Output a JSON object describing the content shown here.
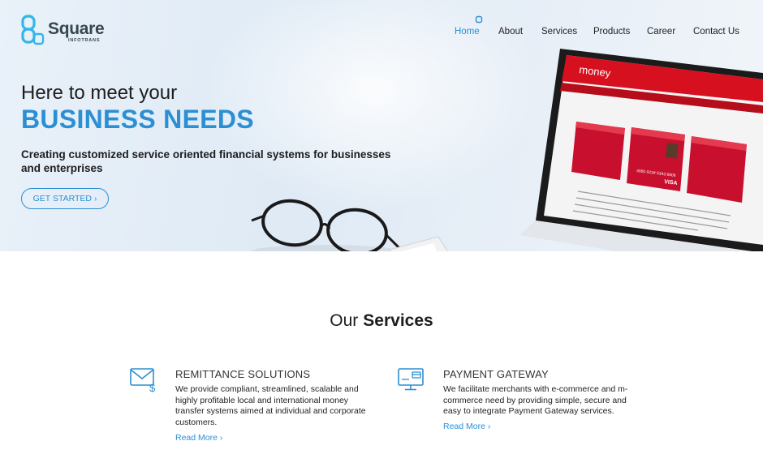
{
  "logo": {
    "name": "Square",
    "sub": "INFOTRANS"
  },
  "nav": {
    "items": [
      {
        "label": "Home",
        "active": true
      },
      {
        "label": "About"
      },
      {
        "label": "Services"
      },
      {
        "label": "Products"
      },
      {
        "label": "Career"
      },
      {
        "label": "Contact Us"
      }
    ]
  },
  "hero": {
    "line1": "Here to meet your",
    "line2": "BUSINESS NEEDS",
    "subtitle": "Creating customized service oriented financial systems for businesses and enterprises",
    "cta_label": "GET STARTED",
    "cta_icon": "chevron-right-icon"
  },
  "artwork": {
    "brand": "money",
    "card_number": "4060 0234 5343 6606",
    "card_network": "VISA"
  },
  "services": {
    "title_light": "Our",
    "title_bold": "Services",
    "items": [
      {
        "icon": "envelope-dollar-icon",
        "title": "REMITTANCE SOLUTIONS",
        "text": "We provide compliant, streamlined, scalable and highly profitable local and international money transfer systems aimed at individual and corporate customers.",
        "link": "Read More"
      },
      {
        "icon": "monitor-card-icon",
        "title": "PAYMENT GATEWAY",
        "text": "We facilitate merchants with e-commerce and m-commerce need by providing simple, secure and easy to integrate Payment Gateway services.",
        "link": "Read More"
      }
    ]
  },
  "colors": {
    "accent": "#2b8fd3",
    "card_red": "#c8102e",
    "text": "#1d1d1d"
  }
}
